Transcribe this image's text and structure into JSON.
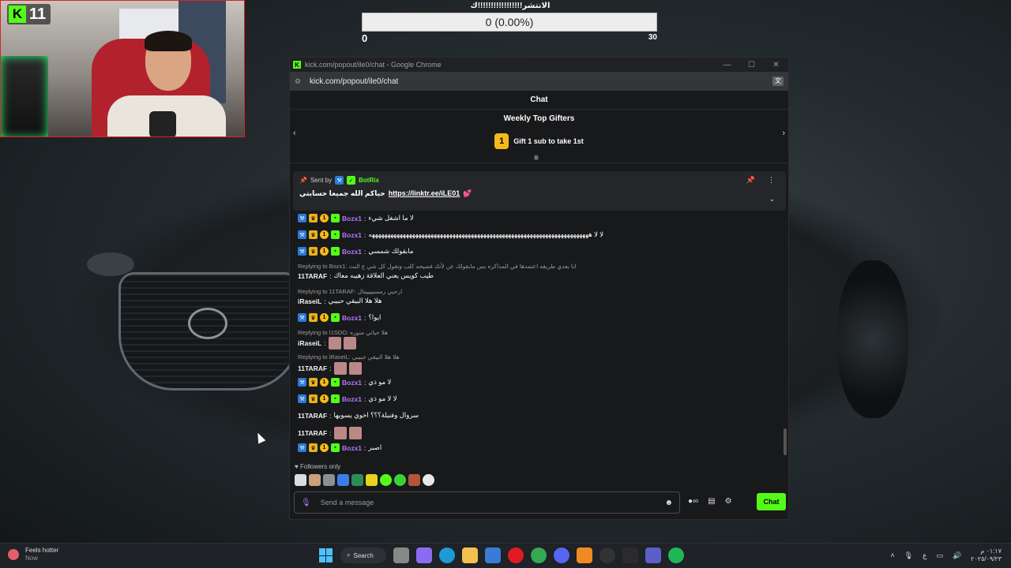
{
  "webcam": {
    "platform_logo": "K",
    "viewer_count": "11"
  },
  "poll": {
    "title": "الانتشر!!!!!!!!!!!!!!!!!ك",
    "bar_text": "0 (0.00%)",
    "min": "0",
    "max": "30",
    "progress": 0
  },
  "window": {
    "title": "kick.com/popout/ile0/chat - Google Chrome",
    "url": "kick.com/popout/ile0/chat",
    "minimize": "—",
    "maximize": "☐",
    "close": "✕"
  },
  "chat": {
    "header": "Chat",
    "gifters_title": "Weekly Top Gifters",
    "gifters_rank": "1",
    "gifters_text": "Gift 1 sub to take 1st",
    "pinned": {
      "sent_by": "Sent by",
      "bot_name": "BotRix",
      "message_arabic": "حياكم الله جميعا حسابتي",
      "message_link": "https://linktr.ee/iLE01"
    },
    "messages": [
      {
        "type": "msg",
        "user": "Bozx1",
        "badges": true,
        "text": "لا ما اشغل شيء"
      },
      {
        "type": "msg",
        "user": "Bozx1",
        "badges": true,
        "text": "لا لا هههههههههههههههههههههههههههههههههههههههههههههههههههههههههههههههههههههههه"
      },
      {
        "type": "msg",
        "user": "Bozx1",
        "badges": true,
        "text": "مابقولك شمسي"
      },
      {
        "type": "reply",
        "text": "Replying to Bozx1: انا بعدي طريقه اعتمدها في المذاكره بس مابقولك عن لأنك فضيحه كلب وتقول كل شي ع البث"
      },
      {
        "type": "msg",
        "user": "11TARAF",
        "badges": false,
        "text": "طيب كويس يعني العلاقة زهيبه معاك"
      },
      {
        "type": "reply",
        "text": "Replying to 11TARAF: ارحبي رمسيييييتال"
      },
      {
        "type": "msg",
        "user": "iRaseiL",
        "badges": false,
        "text": "هلا هلا البيقي حبيبي"
      },
      {
        "type": "msg",
        "user": "Bozx1",
        "badges": true,
        "text": "ايوا؟"
      },
      {
        "type": "reply",
        "text": "Replying to I1SDO: هلا حياتي منوره"
      },
      {
        "type": "msg",
        "user": "iRaseiL",
        "badges": false,
        "text": ""
      },
      {
        "type": "reply",
        "text": "Replying to iRaseiL: هلا هلا البيقي حبيبي"
      },
      {
        "type": "msg",
        "user": "11TARAF",
        "badges": false,
        "text": ""
      },
      {
        "type": "msg",
        "user": "Bozx1",
        "badges": true,
        "text": "لا مو ذي"
      },
      {
        "type": "msg",
        "user": "Bozx1",
        "badges": true,
        "text": "لا لا مو ذي"
      },
      {
        "type": "msg",
        "user": "11TARAF",
        "badges": false,
        "text": "سروال وفنيلة؟؟؟ اخوي يسويها"
      },
      {
        "type": "msg",
        "user": "11TARAF",
        "badges": false,
        "text": ""
      },
      {
        "type": "msg",
        "user": "Bozx1",
        "badges": true,
        "text": "اصبر"
      }
    ],
    "followers_only": "Followers only",
    "input_placeholder": "Send a message",
    "send_label": "Chat"
  },
  "taskbar": {
    "weather_title": "Feels hotter",
    "weather_sub": "Now",
    "search_label": "Search",
    "clock_time": "٠١:١٧ م",
    "clock_date": "٢٠٢٥/٠٩/٢٣",
    "lang": "ع"
  },
  "colors": {
    "kick_green": "#53fc18",
    "username_purple": "#b277ff",
    "gold": "#f5b91b"
  }
}
